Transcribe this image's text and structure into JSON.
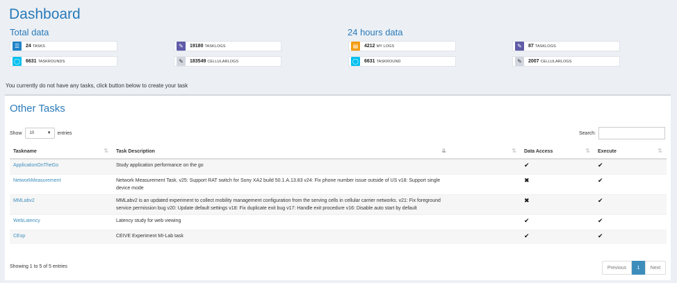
{
  "page": {
    "title": "Dashboard",
    "total_title": "Total data",
    "hours_title": "24 hours data",
    "notice": "You currently do not have any tasks, click button below to create your task"
  },
  "stats": {
    "tasks": {
      "num": "24",
      "label": "TASKS",
      "color": "#1e82c8",
      "icon": "list-icon"
    },
    "tasklogs": {
      "num": "19180",
      "label": "TASKLOGS",
      "color": "#605ca8",
      "icon": "edit-icon"
    },
    "taskrounds": {
      "num": "6631",
      "label": "TASKROUNDS",
      "color": "#00c0ef",
      "icon": "refresh-icon"
    },
    "cellularlogs": {
      "num": "183549",
      "label": "CELLULARLOGS",
      "color": "#d2d6de",
      "icon": "edit-icon"
    },
    "mylogs_24": {
      "num": "4212",
      "label": "MY LOGS",
      "color": "#f39c12",
      "icon": "doc-icon"
    },
    "tasklogs_24": {
      "num": "87",
      "label": "TASKLOGS",
      "color": "#605ca8",
      "icon": "edit-icon"
    },
    "taskround_24": {
      "num": "6631",
      "label": "TASKROUND",
      "color": "#00c0ef",
      "icon": "refresh-icon"
    },
    "cellularlogs_24": {
      "num": "2007",
      "label": "CELLULARLOGS",
      "color": "#d2d6de",
      "icon": "edit-icon"
    }
  },
  "panel": {
    "title": "Other Tasks",
    "show_label": "Show",
    "entries_value": "10",
    "entries_label": "entries",
    "search_label": "Search:",
    "search_value": ""
  },
  "table": {
    "headers": {
      "name": "Taskname",
      "desc": "Task Description",
      "blank": "",
      "access": "Data Access",
      "execute": "Execute"
    },
    "rows": [
      {
        "name": "ApplicationOnTheGo",
        "desc": "Study application performance on the go",
        "access": "✔",
        "execute": "✔"
      },
      {
        "name": "NetworkMeasurement",
        "desc": "Network Measurement Task. v25: Support RAT switch for Sony XA2 build 50.1.A.13.83 v24: Fix phone number issue outside of US v18: Support single device mode",
        "access": "✖",
        "execute": "✔"
      },
      {
        "name": "MMLabv2",
        "desc": "MMLabv2 is an updated experiment to collect mobility management configuration from the serving cells in cellular carrier networks. v21: Fix foreground service permission bug v20: Update default settings v18: Fix duplicate exit bug v17: Handle exit procedure v16: Disable auto start by default",
        "access": "✖",
        "execute": "✔"
      },
      {
        "name": "WebLatency",
        "desc": "Latency study for web viewing",
        "access": "✔",
        "execute": "✔"
      },
      {
        "name": "CExp",
        "desc": "CEIVE Experiment MI-Lab task",
        "access": "✔",
        "execute": "✔"
      }
    ]
  },
  "footer": {
    "info": "Showing 1 to 5 of 5 entries",
    "prev": "Previous",
    "page": "1",
    "next": "Next"
  }
}
